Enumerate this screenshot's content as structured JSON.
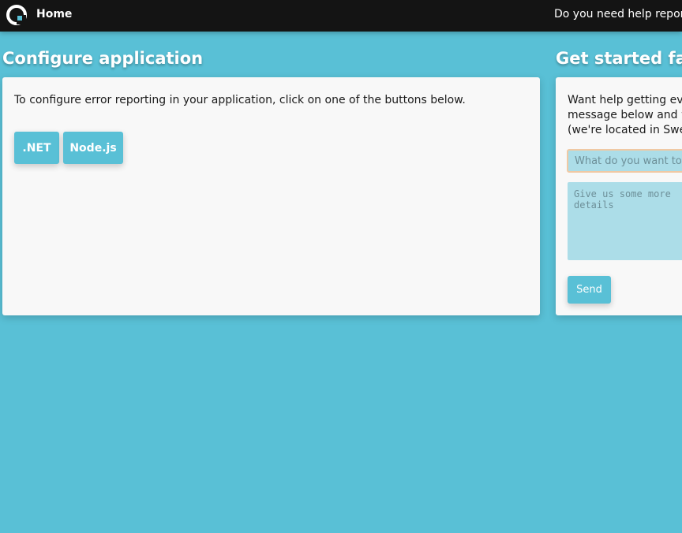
{
  "nav": {
    "home_label": "Home",
    "help_label": "Do you need help reporting"
  },
  "configure": {
    "title": "Configure application",
    "description": "To configure error reporting in your application, click on one of the buttons below.",
    "buttons": [
      ".NET",
      "Node.js"
    ]
  },
  "get_started": {
    "title": "Get started fast",
    "description_lines": [
      "Want help getting every",
      "message below and w",
      "(we're located in Swe"
    ],
    "subject_placeholder": "What do you want to talk about",
    "body_placeholder": "Give us some more details",
    "send_label": "Send"
  },
  "colors": {
    "background": "#59c0d6",
    "topbar": "#141414",
    "accent": "#59c0d6",
    "panel": "#f8f8f8",
    "input_bg": "#acdde8"
  },
  "icons": {
    "logo": "app-logo-icon"
  }
}
